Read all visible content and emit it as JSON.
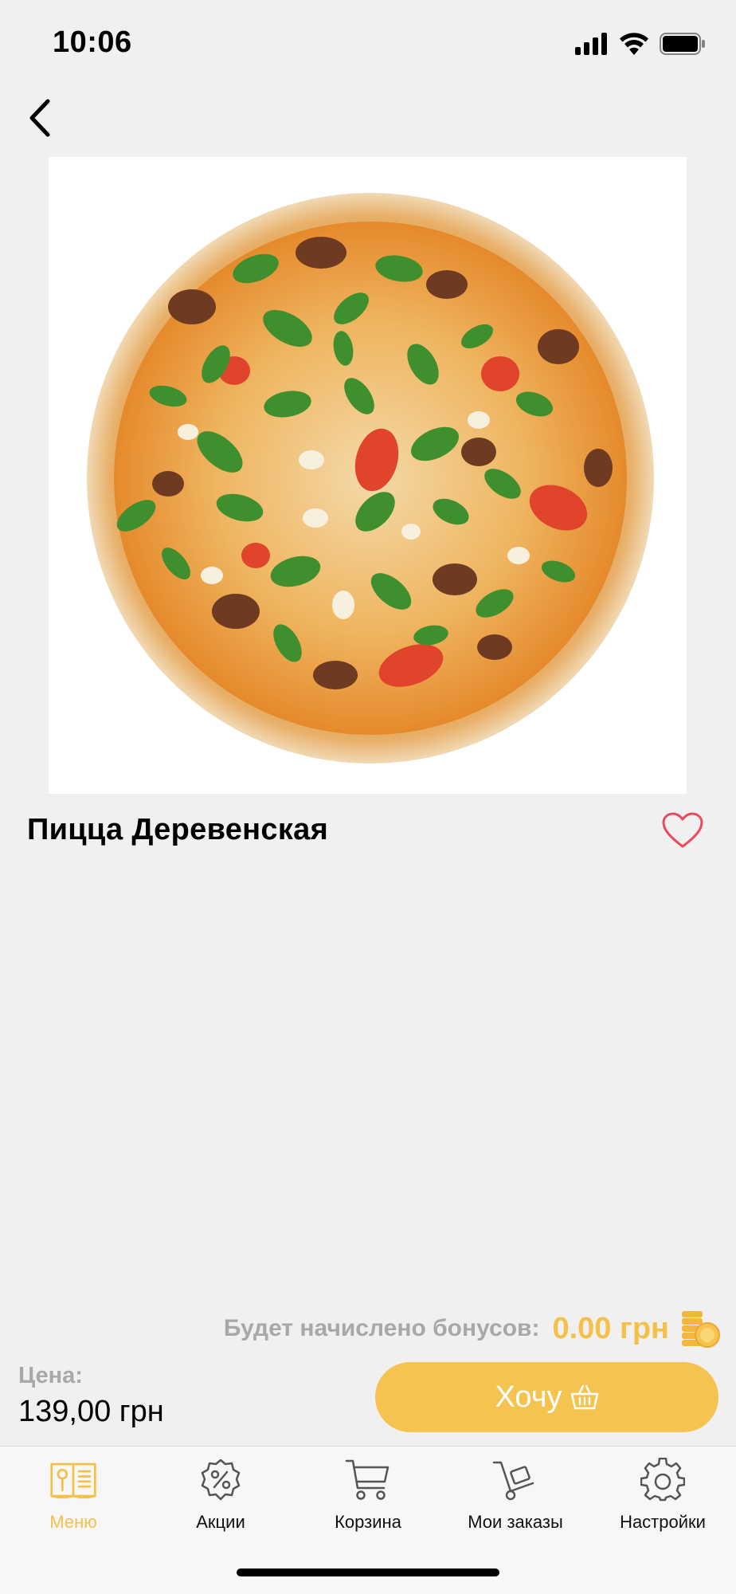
{
  "status_bar": {
    "time": "10:06"
  },
  "product": {
    "title": "Пицца Деревенская",
    "image_icon": "pizza-photo"
  },
  "bonus": {
    "label": "Будет начислено бонусов:",
    "value": "0.00 грн",
    "icon": "coins-icon"
  },
  "price": {
    "label": "Цена:",
    "value": "139,00 грн"
  },
  "want_button": {
    "label": "Хочу",
    "icon": "basket-icon"
  },
  "tabs": [
    {
      "label": "Меню",
      "icon": "menu-book-icon",
      "active": true
    },
    {
      "label": "Акции",
      "icon": "percent-badge-icon",
      "active": false
    },
    {
      "label": "Корзина",
      "icon": "cart-icon",
      "active": false
    },
    {
      "label": "Мои заказы",
      "icon": "hand-truck-icon",
      "active": false
    },
    {
      "label": "Настройки",
      "icon": "gear-icon",
      "active": false
    }
  ],
  "colors": {
    "accent": "#f5c34f",
    "background": "#f0f0f0",
    "muted_text": "#a8a8a8",
    "heart": "#e94b5c"
  }
}
